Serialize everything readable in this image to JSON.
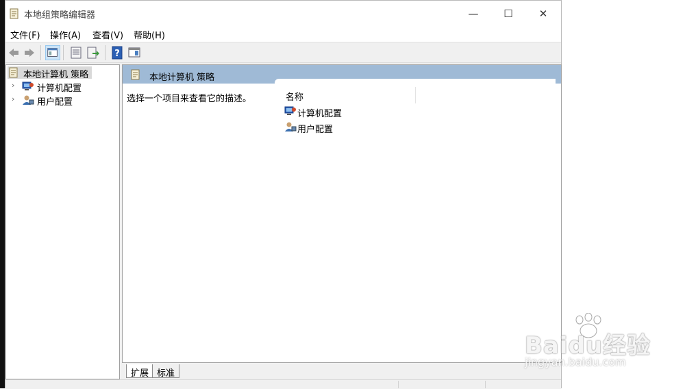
{
  "window": {
    "title": "本地组策略编辑器",
    "minimize_glyph": "—",
    "maximize_glyph": "☐",
    "close_glyph": "✕"
  },
  "menu": {
    "items": [
      "文件(F)",
      "操作(A)",
      "查看(V)",
      "帮助(H)"
    ]
  },
  "toolbar": {
    "icons": [
      "back-icon",
      "forward-icon",
      "show-hide-console-tree-icon",
      "properties-icon",
      "export-list-icon",
      "help-icon",
      "show-action-pane-icon"
    ],
    "active": "show-hide-console-tree-icon"
  },
  "tree": {
    "root": "本地计算机 策略",
    "nodes": [
      {
        "label": "计算机配置",
        "chevron": "›"
      },
      {
        "label": "用户配置",
        "chevron": "›"
      }
    ]
  },
  "main": {
    "header_title": "本地计算机 策略",
    "description": "选择一个项目来查看它的描述。",
    "column_name": "名称",
    "items": [
      "计算机配置",
      "用户配置"
    ]
  },
  "tabs": [
    "扩展",
    "标准"
  ],
  "watermark": {
    "main": "Baidu经验",
    "sub": "jingyan.baidu.com"
  },
  "colors": {
    "header_bg": "#9fbad6",
    "tree_selected_bg": "#d9d9d9",
    "toolbar_active_bg": "#cce4f7"
  }
}
